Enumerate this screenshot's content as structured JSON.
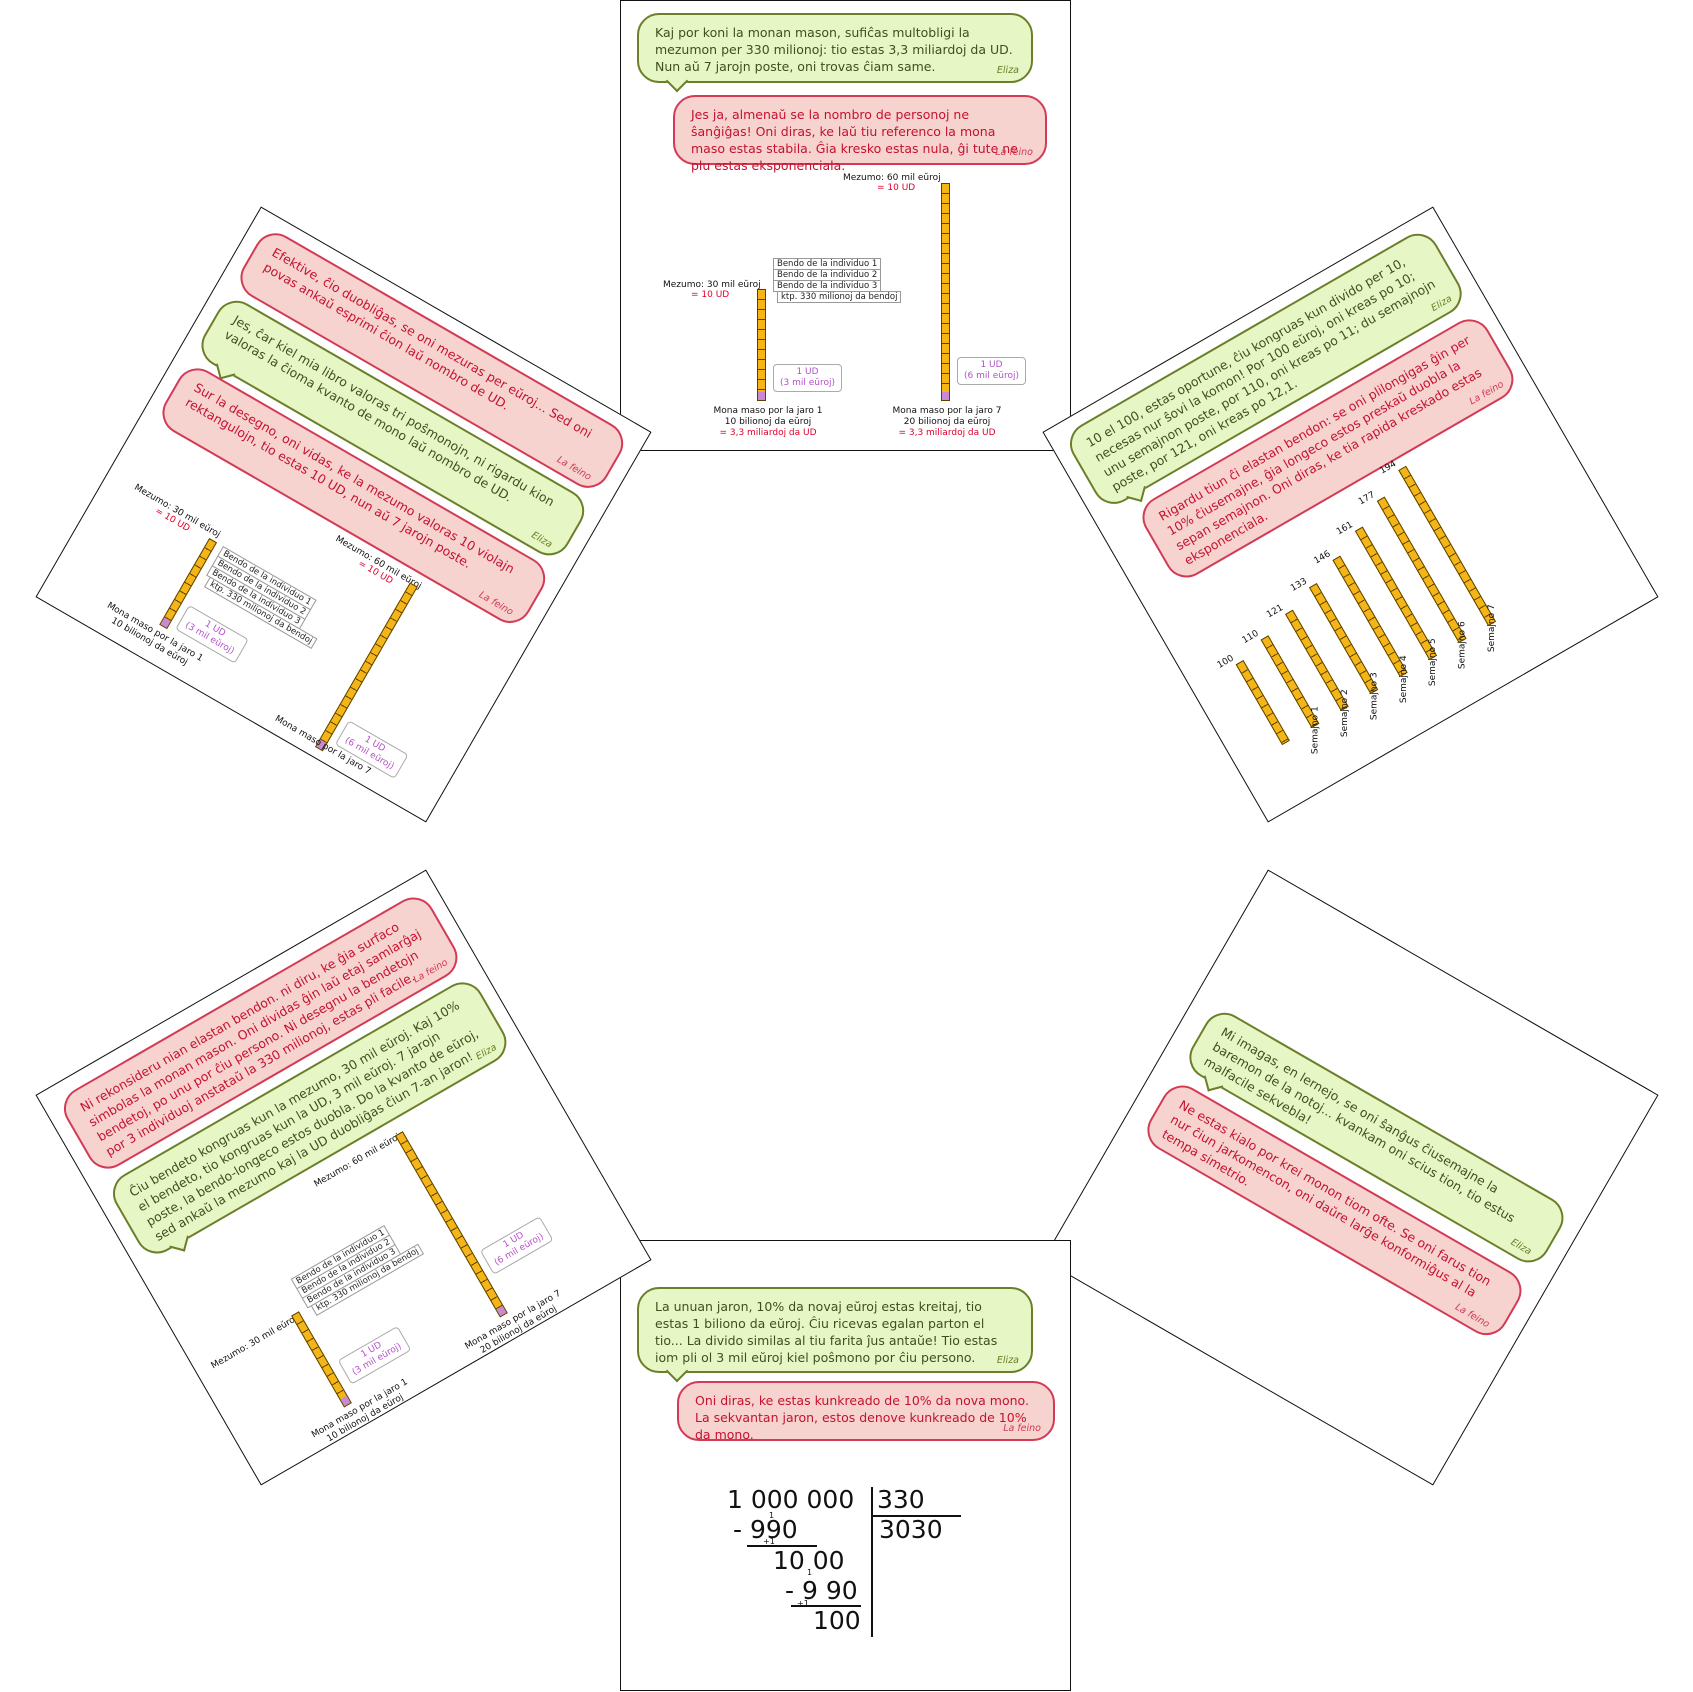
{
  "panels": {
    "top": {
      "bubble_eliza": "Kaj por koni la monan mason, sufiĉas multobligi la mezumon per 330 milionoj: tio estas 3,3 miliardoj da UD. Nun aŭ 7 jarojn poste, oni trovas ĉiam same.",
      "bubble_feino": "Jes ja, almenaŭ se la nombro de personoj ne ŝanĝiĝas! Oni diras, ke laŭ tiu referenco la mona maso estas stabila. Ĝia kresko estas nula, ĝi tute ne plu estas eksponenciala.",
      "sig_eliza": "Eliza",
      "sig_feino": "La feino",
      "mezumo30": "Mezumo: 30 mil eŭroj",
      "ud10a": "= 10 UD",
      "mezumo60": "Mezumo: 60 mil eŭroj",
      "ud10b": "= 10 UD",
      "bendo1": "Bendo de la individuo 1",
      "bendo2": "Bendo de la individuo 2",
      "bendo3": "Bendo de la individuo 3",
      "ktp": "ktp. 330 milionoj da bendoj",
      "ud_box1_a": "1 UD",
      "ud_box1_b": "(3 mil eŭroj)",
      "ud_box2_a": "1 UD",
      "ud_box2_b": "(6 mil eŭroj)",
      "mm1_a": "Mona maso por la jaro 1",
      "mm1_b": "10 bilionoj da eŭroj",
      "mm1_c": "= 3,3 miliardoj da UD",
      "mm7_a": "Mona maso por la jaro 7",
      "mm7_b": "20 bilionoj da eŭroj",
      "mm7_c": "= 3,3 miliardoj da UD"
    },
    "upper_right": {
      "bubble_eliza": "10 el 100, estas oportune, ĉiu kongruas kun divido per 10, necesas nur ŝovi la komon! Por 100 eŭroj, oni kreas po 10; unu semajnon poste, por 110, oni kreas po 11; du semajnojn poste, por 121, oni kreas po 12,1.",
      "bubble_feino": "Rigardu tiun ĉi elastan bendon: se oni plilongigas ĝin per 10% ĉiusemajne, ĝia longeco estos preskaŭ duobla la sepan semajnon. Oni diras, ke tia rapida kreskado estas eksponenciala.",
      "sig_eliza": "Eliza",
      "sig_feino": "La feino",
      "values": [
        "100",
        "110",
        "121",
        "133",
        "146",
        "161",
        "177",
        "194"
      ],
      "weeks": [
        "Semajno 1",
        "Semajno 2",
        "Semajno 3",
        "Semajno 4",
        "Semajno 5",
        "Semajno 6",
        "Semajno 7"
      ]
    },
    "lower_right": {
      "bubble_eliza": "Mi imagas, en lernejo, se oni ŝanĝus ĉiusemajne la baremon de la notoj... kvankam oni scius tion, tio estus malfacile sekvebla!",
      "bubble_feino": "Ne estas kialo por krei monon tiom ofte. Se oni farus tion nur ĉiun jarkomencon, oni daŭre larĝe konformiĝus al la tempa simetrio.",
      "sig_eliza": "Eliza",
      "sig_feino": "La feino"
    },
    "bottom": {
      "bubble_eliza": "La unuan jaron, 10% da novaj eŭroj estas kreitaj, tio estas 1 biliono da eŭroj. Ĉiu ricevas egalan parton el tio... La divido similas al tiu farita ĵus antaŭe! Tio estas iom pli ol 3 mil eŭroj kiel poŝmono por ĉiu persono.",
      "bubble_feino": "Oni diras, ke estas kunkreado de 10% da nova mono. La sekvantan jaron, estos denove kunkreado de 10% da mono.",
      "sig_eliza": "Eliza",
      "sig_feino": "La feino",
      "division": {
        "dividend": "1 000 000",
        "divisor": "330",
        "quotient": "3030",
        "sub1": "- 990",
        "rem1": "10 00",
        "sub2": "- 9 90",
        "rem2": "100",
        "carry1": "1",
        "carry2": "+1",
        "carry3": "1",
        "carry4": "+1"
      }
    },
    "lower_left": {
      "bubble_feino": "Ni rekonsideru nian elastan bendon. ni diru, ke ĝia surfaco simbolas la monan mason. Oni dividas ĝin laŭ etaj samlarĝaj bendetoj, po unu por ĉiu persono. Ni desegnu la bendetojn por 3 individuoj anstataŭ la 330 milionoj, estas pli facile.",
      "bubble_eliza": "Ĉiu bendeto kongruas kun la mezumo, 30 mil eŭroj. Kaj 10% el bendeto, tio kongruas kun la UD, 3 mil eŭroj. 7 jarojn poste, la bendo-longeco estos duobla. Do la kvanto de eŭroj, sed ankaŭ la mezumo kaj la UD duobliĝas ĉiun 7-an jaron!",
      "sig_eliza": "Eliza",
      "sig_feino": "La feino",
      "mezumo30": "Mezumo: 30 mil eŭroj",
      "mezumo60": "Mezumo: 60 mil eŭroj",
      "bendo1": "Bendo de la individuo 1",
      "bendo2": "Bendo de la individuo 2",
      "bendo3": "Bendo de la individuo 3",
      "ktp": "ktp. 330 milionoj da bendoj",
      "ud_box1_a": "1 UD",
      "ud_box1_b": "(3 mil eŭroj)",
      "ud_box2_a": "1 UD",
      "ud_box2_b": "(6 mil eŭroj)",
      "mm1_a": "Mona maso por la jaro 1",
      "mm1_b": "10 bilionoj da eŭroj",
      "mm7_a": "Mona maso por la jaro 7",
      "mm7_b": "20 bilionoj da eŭroj"
    },
    "upper_left": {
      "bubble_feino1": "Efektive, ĉio duobliĝas, se oni mezuras per eŭroj... Sed oni povas ankaŭ esprimi ĉion laŭ nombro de UD.",
      "bubble_eliza": "Jes, ĉar kiel mia libro valoras tri poŝmonojn, ni rigardu kion valoras la ĉioma kvanto de mono laŭ nombro de UD.",
      "bubble_feino2": "Sur la desegno, oni vidas, ke la mezumo valoras 10 violajn rektangulojn, tio estas 10 UD, nun aŭ 7 jarojn poste.",
      "sig_eliza": "Eliza",
      "sig_feino": "La feino",
      "mezumo30": "Mezumo: 30 mil eŭroj",
      "ud10a": "= 10 UD",
      "mezumo60": "Mezumo: 60 mil eŭroj",
      "ud10b": "= 10 UD",
      "bendo1": "Bendo de la individuo 1",
      "bendo2": "Bendo de la individuo 2",
      "bendo3": "Bendo de la individuo 3",
      "ktp": "ktp. 330 milionoj da bendoj",
      "ud_box1_a": "1 UD",
      "ud_box1_b": "(3 mil eŭroj)",
      "ud_box2_a": "1 UD",
      "ud_box2_b": "(6 mil eŭroj)",
      "mm1_a": "Mona maso por la jaro 1",
      "mm1_b": "10 bilionoj da eŭroj",
      "mm7_a": "Mona maso por la jaro 7",
      "mm7_b": "20 bilionoj da eŭroj"
    }
  }
}
